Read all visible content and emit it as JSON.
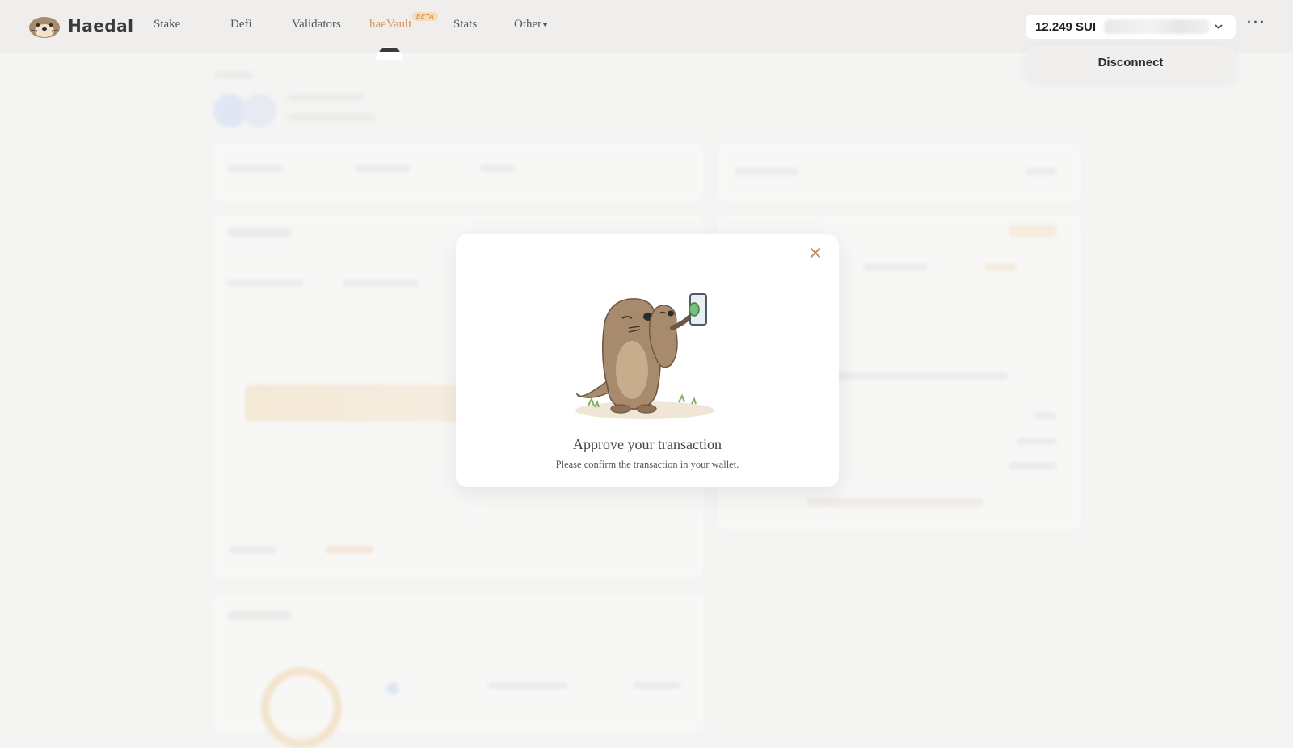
{
  "header": {
    "logo_text": "Haedal",
    "nav": [
      {
        "label": "Stake"
      },
      {
        "label": "Defi"
      },
      {
        "label": "Validators"
      },
      {
        "label": "haeVault",
        "badge": "BETA",
        "active": true
      },
      {
        "label": "Stats"
      },
      {
        "label": "Other"
      }
    ],
    "wallet": {
      "balance": "12.249 SUI"
    },
    "more_label": "···",
    "disconnect_label": "Disconnect"
  },
  "modal": {
    "title": "Approve your transaction",
    "subtitle": "Please confirm the transaction in your wallet.",
    "close_label": "✕",
    "illustration": "otter-pressing-button"
  },
  "colors": {
    "accent": "#d2955b",
    "background": "#f4f4f3",
    "topbar": "#efeeec",
    "modal_bg": "#ffffff"
  }
}
